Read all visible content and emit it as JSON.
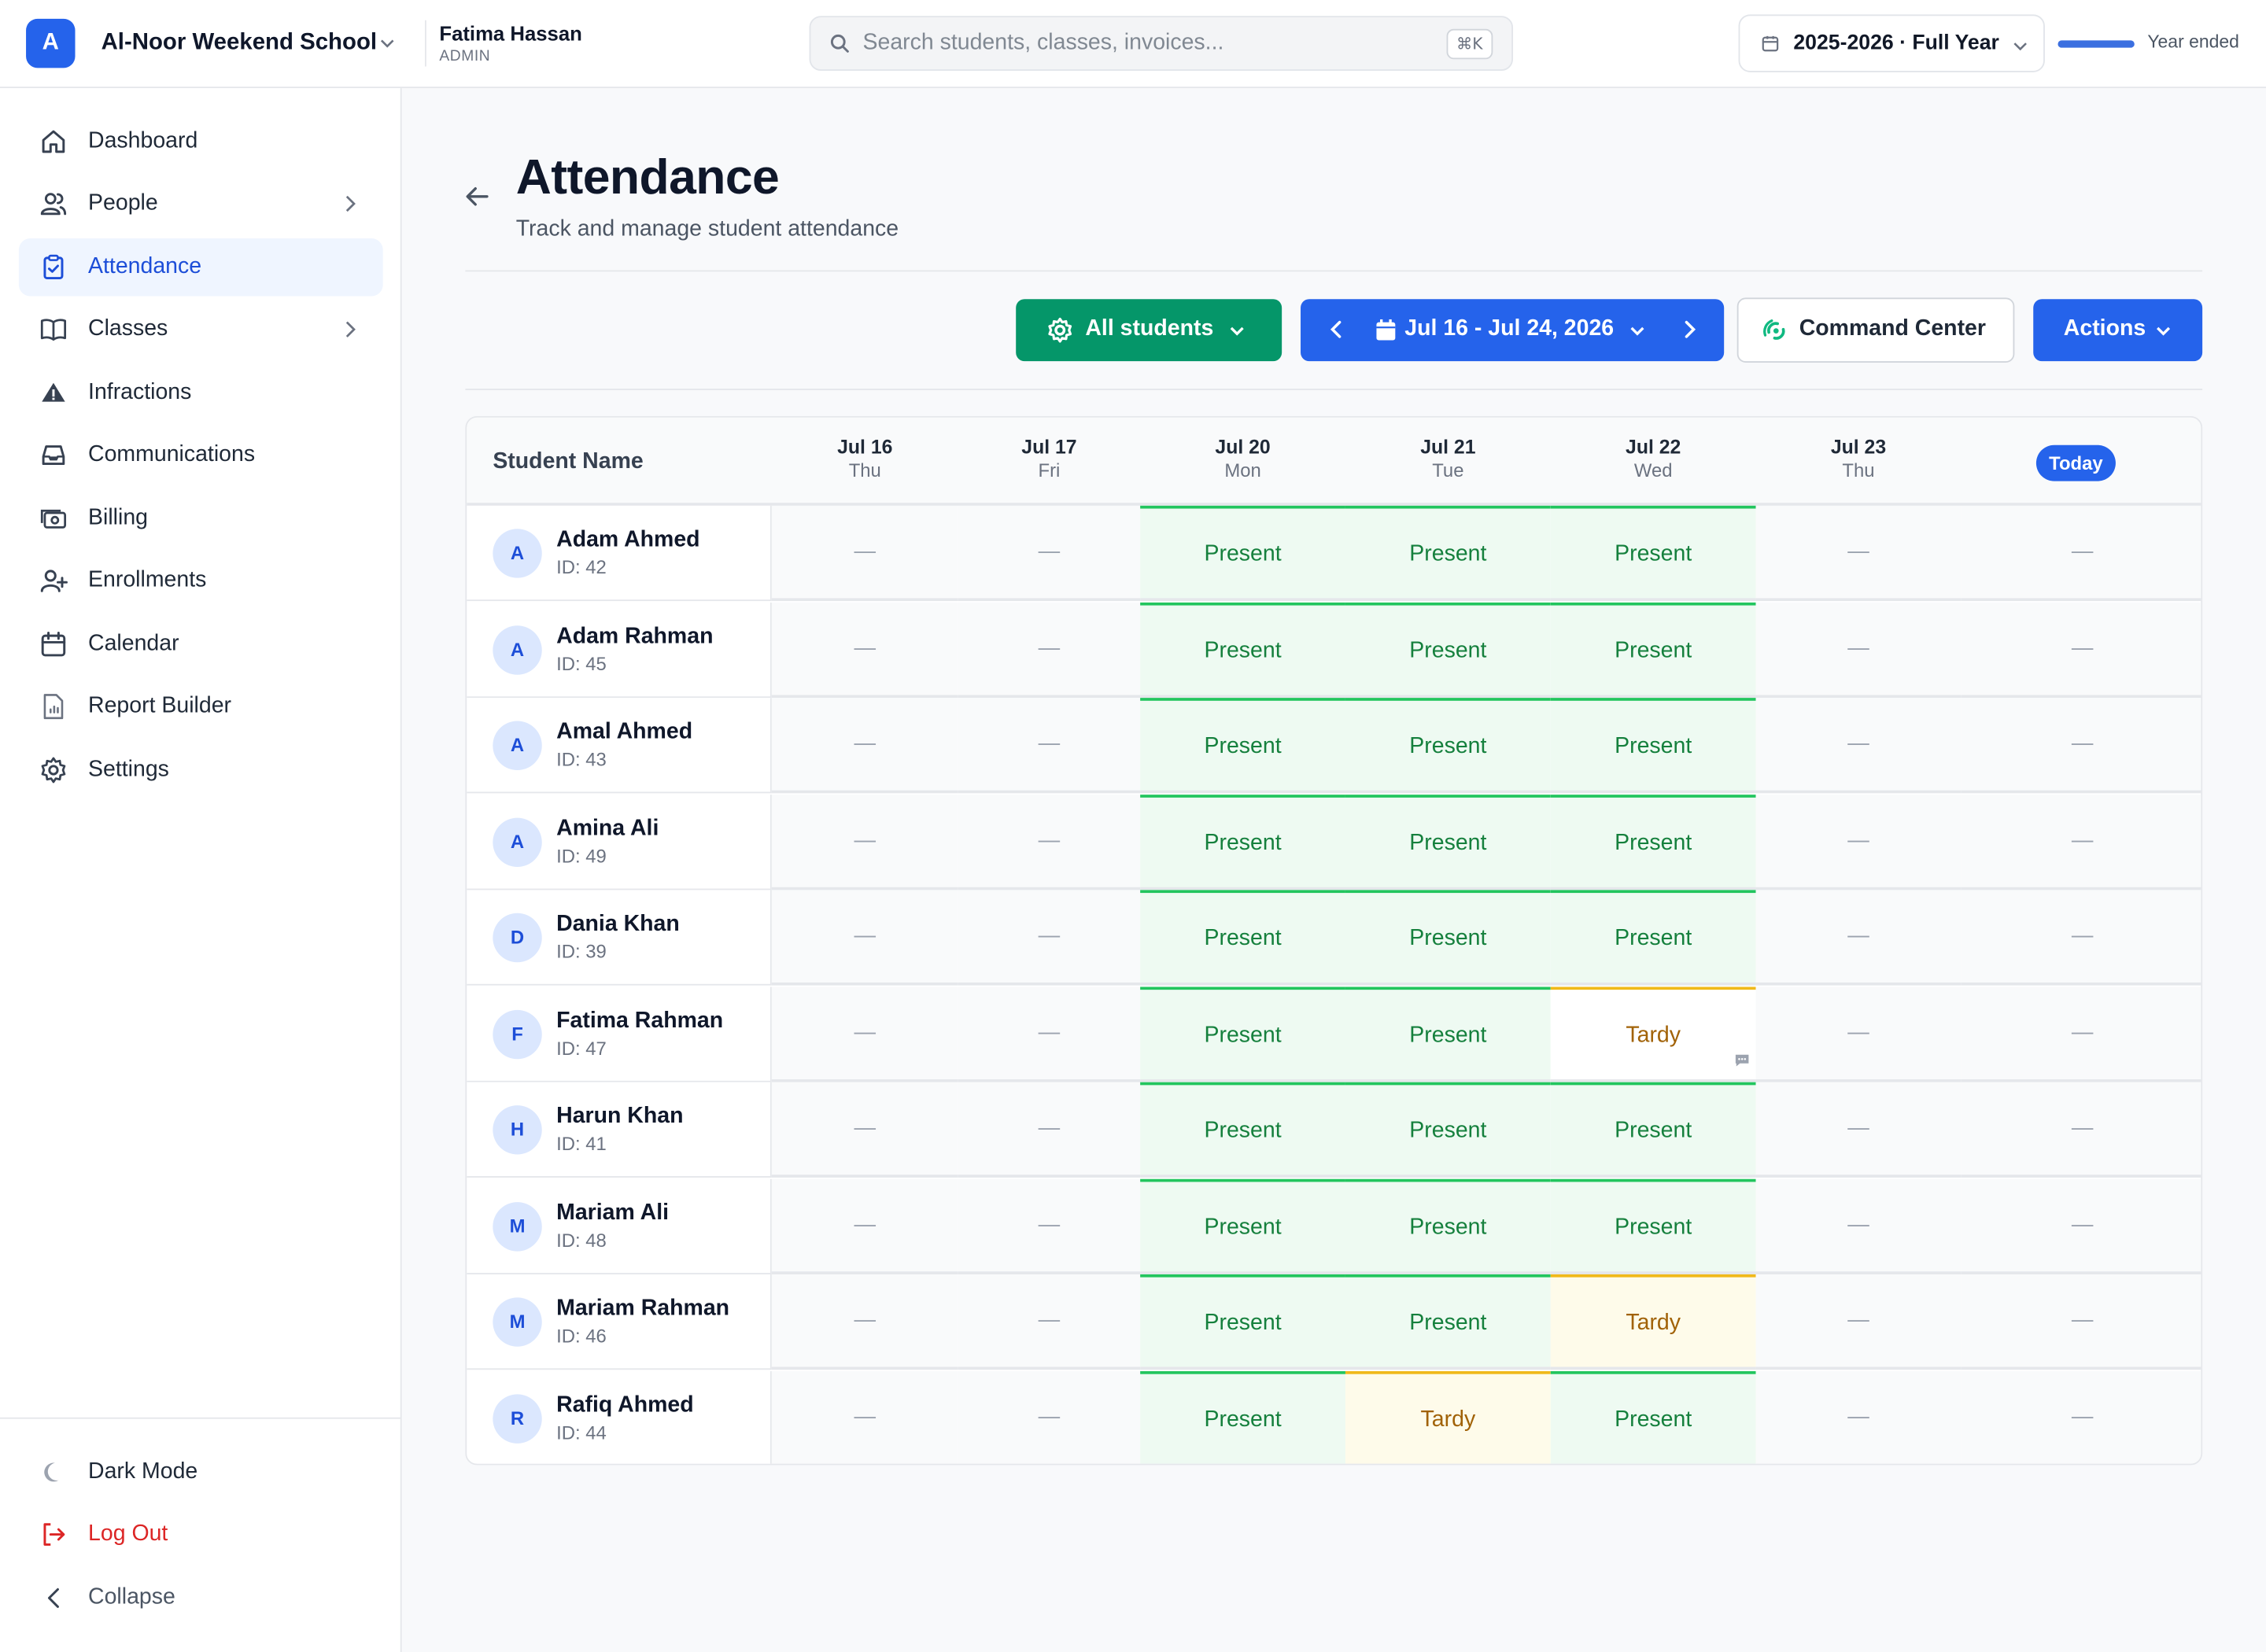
{
  "org": {
    "initial": "A",
    "name": "Al-Noor Weekend School"
  },
  "user": {
    "name": "Fatima Hassan",
    "role": "ADMIN"
  },
  "search": {
    "placeholder": "Search students, classes, invoices...",
    "shortcut": "⌘K"
  },
  "year": {
    "label": "2025-2026 · Full Year",
    "status": "Year ended",
    "progress": 1.0
  },
  "sidebar": {
    "items": [
      {
        "label": "Dashboard",
        "icon": "home-icon"
      },
      {
        "label": "People",
        "icon": "users-icon",
        "has_children": true
      },
      {
        "label": "Attendance",
        "icon": "clipboard-check-icon",
        "active": true
      },
      {
        "label": "Classes",
        "icon": "book-open-icon",
        "has_children": true
      },
      {
        "label": "Infractions",
        "icon": "warning-icon"
      },
      {
        "label": "Communications",
        "icon": "inbox-icon"
      },
      {
        "label": "Billing",
        "icon": "money-icon"
      },
      {
        "label": "Enrollments",
        "icon": "user-plus-icon"
      },
      {
        "label": "Calendar",
        "icon": "calendar-icon"
      },
      {
        "label": "Report Builder",
        "icon": "report-icon"
      },
      {
        "label": "Settings",
        "icon": "gear-icon"
      }
    ],
    "bottom": {
      "dark_mode": "Dark Mode",
      "logout": "Log Out",
      "collapse": "Collapse"
    }
  },
  "page": {
    "title": "Attendance",
    "subtitle": "Track and manage student attendance"
  },
  "toolbar": {
    "filter_label": "All students",
    "range_label": "Jul 16 - Jul 24, 2026",
    "command_center": "Command Center",
    "actions": "Actions"
  },
  "table": {
    "name_header": "Student Name",
    "today_label": "Today",
    "days": [
      {
        "date": "Jul 16",
        "weekday": "Thu"
      },
      {
        "date": "Jul 17",
        "weekday": "Fri"
      },
      {
        "date": "Jul 20",
        "weekday": "Mon"
      },
      {
        "date": "Jul 21",
        "weekday": "Tue"
      },
      {
        "date": "Jul 22",
        "weekday": "Wed"
      },
      {
        "date": "Jul 23",
        "weekday": "Thu"
      }
    ],
    "students": [
      {
        "initial": "A",
        "name": "Adam Ahmed",
        "id": "ID: 42",
        "marks": [
          "—",
          "—",
          "Present",
          "Present",
          "Present",
          "—",
          "—"
        ]
      },
      {
        "initial": "A",
        "name": "Adam Rahman",
        "id": "ID: 45",
        "marks": [
          "—",
          "—",
          "Present",
          "Present",
          "Present",
          "—",
          "—"
        ]
      },
      {
        "initial": "A",
        "name": "Amal Ahmed",
        "id": "ID: 43",
        "marks": [
          "—",
          "—",
          "Present",
          "Present",
          "Present",
          "—",
          "—"
        ]
      },
      {
        "initial": "A",
        "name": "Amina Ali",
        "id": "ID: 49",
        "marks": [
          "—",
          "—",
          "Present",
          "Present",
          "Present",
          "—",
          "—"
        ]
      },
      {
        "initial": "D",
        "name": "Dania Khan",
        "id": "ID: 39",
        "marks": [
          "—",
          "—",
          "Present",
          "Present",
          "Present",
          "—",
          "—"
        ]
      },
      {
        "initial": "F",
        "name": "Fatima Rahman",
        "id": "ID: 47",
        "marks": [
          "—",
          "—",
          "Present",
          "Present",
          "Tardy",
          "—",
          "—"
        ],
        "note_col": 4
      },
      {
        "initial": "H",
        "name": "Harun Khan",
        "id": "ID: 41",
        "marks": [
          "—",
          "—",
          "Present",
          "Present",
          "Present",
          "—",
          "—"
        ]
      },
      {
        "initial": "M",
        "name": "Mariam Ali",
        "id": "ID: 48",
        "marks": [
          "—",
          "—",
          "Present",
          "Present",
          "Present",
          "—",
          "—"
        ]
      },
      {
        "initial": "M",
        "name": "Mariam Rahman",
        "id": "ID: 46",
        "marks": [
          "—",
          "—",
          "Present",
          "Present",
          "Tardy",
          "—",
          "—"
        ]
      },
      {
        "initial": "R",
        "name": "Rafiq Ahmed",
        "id": "ID: 44",
        "marks": [
          "—",
          "—",
          "Present",
          "Tardy",
          "Present",
          "—",
          "—"
        ]
      }
    ]
  },
  "colors": {
    "accent": "#2563eb",
    "filter_button": "#059669",
    "present_text": "#15803d",
    "present_bg": "#eefaf2",
    "present_top": "#22c55e",
    "tardy_text": "#a16207",
    "tardy_bg": "#fefbea",
    "tardy_top": "#f0b91a",
    "logout": "#dc2626"
  }
}
